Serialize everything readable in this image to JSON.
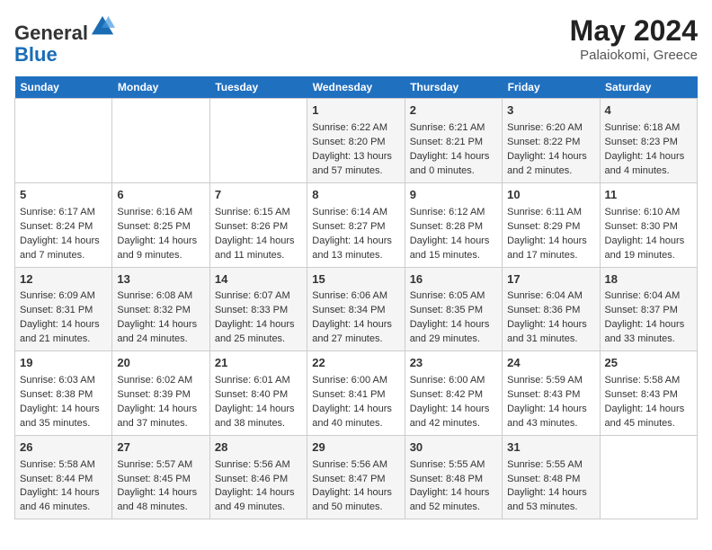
{
  "header": {
    "logo_line1": "General",
    "logo_line2": "Blue",
    "month_year": "May 2024",
    "location": "Palaiokomi, Greece"
  },
  "days_of_week": [
    "Sunday",
    "Monday",
    "Tuesday",
    "Wednesday",
    "Thursday",
    "Friday",
    "Saturday"
  ],
  "weeks": [
    [
      {
        "day": "",
        "info": ""
      },
      {
        "day": "",
        "info": ""
      },
      {
        "day": "",
        "info": ""
      },
      {
        "day": "1",
        "info": "Sunrise: 6:22 AM\nSunset: 8:20 PM\nDaylight: 13 hours\nand 57 minutes."
      },
      {
        "day": "2",
        "info": "Sunrise: 6:21 AM\nSunset: 8:21 PM\nDaylight: 14 hours\nand 0 minutes."
      },
      {
        "day": "3",
        "info": "Sunrise: 6:20 AM\nSunset: 8:22 PM\nDaylight: 14 hours\nand 2 minutes."
      },
      {
        "day": "4",
        "info": "Sunrise: 6:18 AM\nSunset: 8:23 PM\nDaylight: 14 hours\nand 4 minutes."
      }
    ],
    [
      {
        "day": "5",
        "info": "Sunrise: 6:17 AM\nSunset: 8:24 PM\nDaylight: 14 hours\nand 7 minutes."
      },
      {
        "day": "6",
        "info": "Sunrise: 6:16 AM\nSunset: 8:25 PM\nDaylight: 14 hours\nand 9 minutes."
      },
      {
        "day": "7",
        "info": "Sunrise: 6:15 AM\nSunset: 8:26 PM\nDaylight: 14 hours\nand 11 minutes."
      },
      {
        "day": "8",
        "info": "Sunrise: 6:14 AM\nSunset: 8:27 PM\nDaylight: 14 hours\nand 13 minutes."
      },
      {
        "day": "9",
        "info": "Sunrise: 6:12 AM\nSunset: 8:28 PM\nDaylight: 14 hours\nand 15 minutes."
      },
      {
        "day": "10",
        "info": "Sunrise: 6:11 AM\nSunset: 8:29 PM\nDaylight: 14 hours\nand 17 minutes."
      },
      {
        "day": "11",
        "info": "Sunrise: 6:10 AM\nSunset: 8:30 PM\nDaylight: 14 hours\nand 19 minutes."
      }
    ],
    [
      {
        "day": "12",
        "info": "Sunrise: 6:09 AM\nSunset: 8:31 PM\nDaylight: 14 hours\nand 21 minutes."
      },
      {
        "day": "13",
        "info": "Sunrise: 6:08 AM\nSunset: 8:32 PM\nDaylight: 14 hours\nand 24 minutes."
      },
      {
        "day": "14",
        "info": "Sunrise: 6:07 AM\nSunset: 8:33 PM\nDaylight: 14 hours\nand 25 minutes."
      },
      {
        "day": "15",
        "info": "Sunrise: 6:06 AM\nSunset: 8:34 PM\nDaylight: 14 hours\nand 27 minutes."
      },
      {
        "day": "16",
        "info": "Sunrise: 6:05 AM\nSunset: 8:35 PM\nDaylight: 14 hours\nand 29 minutes."
      },
      {
        "day": "17",
        "info": "Sunrise: 6:04 AM\nSunset: 8:36 PM\nDaylight: 14 hours\nand 31 minutes."
      },
      {
        "day": "18",
        "info": "Sunrise: 6:04 AM\nSunset: 8:37 PM\nDaylight: 14 hours\nand 33 minutes."
      }
    ],
    [
      {
        "day": "19",
        "info": "Sunrise: 6:03 AM\nSunset: 8:38 PM\nDaylight: 14 hours\nand 35 minutes."
      },
      {
        "day": "20",
        "info": "Sunrise: 6:02 AM\nSunset: 8:39 PM\nDaylight: 14 hours\nand 37 minutes."
      },
      {
        "day": "21",
        "info": "Sunrise: 6:01 AM\nSunset: 8:40 PM\nDaylight: 14 hours\nand 38 minutes."
      },
      {
        "day": "22",
        "info": "Sunrise: 6:00 AM\nSunset: 8:41 PM\nDaylight: 14 hours\nand 40 minutes."
      },
      {
        "day": "23",
        "info": "Sunrise: 6:00 AM\nSunset: 8:42 PM\nDaylight: 14 hours\nand 42 minutes."
      },
      {
        "day": "24",
        "info": "Sunrise: 5:59 AM\nSunset: 8:43 PM\nDaylight: 14 hours\nand 43 minutes."
      },
      {
        "day": "25",
        "info": "Sunrise: 5:58 AM\nSunset: 8:43 PM\nDaylight: 14 hours\nand 45 minutes."
      }
    ],
    [
      {
        "day": "26",
        "info": "Sunrise: 5:58 AM\nSunset: 8:44 PM\nDaylight: 14 hours\nand 46 minutes."
      },
      {
        "day": "27",
        "info": "Sunrise: 5:57 AM\nSunset: 8:45 PM\nDaylight: 14 hours\nand 48 minutes."
      },
      {
        "day": "28",
        "info": "Sunrise: 5:56 AM\nSunset: 8:46 PM\nDaylight: 14 hours\nand 49 minutes."
      },
      {
        "day": "29",
        "info": "Sunrise: 5:56 AM\nSunset: 8:47 PM\nDaylight: 14 hours\nand 50 minutes."
      },
      {
        "day": "30",
        "info": "Sunrise: 5:55 AM\nSunset: 8:48 PM\nDaylight: 14 hours\nand 52 minutes."
      },
      {
        "day": "31",
        "info": "Sunrise: 5:55 AM\nSunset: 8:48 PM\nDaylight: 14 hours\nand 53 minutes."
      },
      {
        "day": "",
        "info": ""
      }
    ]
  ]
}
